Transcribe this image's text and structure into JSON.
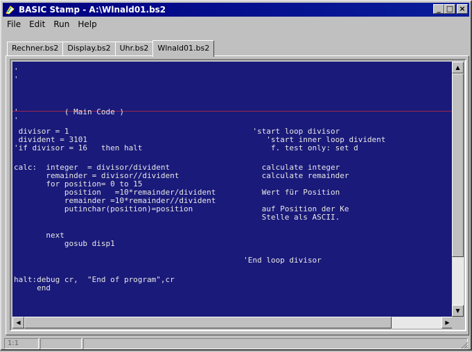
{
  "window": {
    "title": "BASIC Stamp - A:\\Wlnald01.bs2",
    "minimize": "_",
    "maximize": "□",
    "close": "×"
  },
  "menu": [
    "File",
    "Edit",
    "Run",
    "Help"
  ],
  "tabs": [
    {
      "label": "Rechner.bs2",
      "active": false
    },
    {
      "label": "Display.bs2",
      "active": false
    },
    {
      "label": "Uhr.bs2",
      "active": false
    },
    {
      "label": "Wlnald01.bs2",
      "active": true
    }
  ],
  "code_lines": [
    {
      "text": "'",
      "row": 0
    },
    {
      "text": "'",
      "row": 1
    },
    {
      "text": "'          ( Main Code )",
      "row": 2
    },
    {
      "text": "'",
      "row": 3
    },
    {
      "text": " divisor = 1                                        'start loop divisor",
      "row": 4
    },
    {
      "text": " divident = 3101                                       'start inner loop divident",
      "row": 5
    },
    {
      "text": "'if divisor = 16   then halt                            f. test only: set d",
      "row": 6
    },
    {
      "text": "calc:  integer  = divisor/divident                    calculate integer",
      "row": 7
    },
    {
      "text": "       remainder = divisor//divident                  calculate remainder",
      "row": 8
    },
    {
      "text": "       for position= 0 to 15",
      "row": 9
    },
    {
      "text": "           position   =10*remainder/divident          Wert für Position",
      "row": 10
    },
    {
      "text": "           remainder =10*remainder//divident",
      "row": 11
    },
    {
      "text": "           putinchar(position)=position               auf Position der Ke",
      "row": 12
    },
    {
      "text": "                                                      Stelle als ASCII.",
      "row": 13
    },
    {
      "text": "       next",
      "row": 14
    },
    {
      "text": "           gosub disp1",
      "row": 15
    },
    {
      "text": "                                                  'End loop divisor",
      "row": 16
    },
    {
      "text": "halt:debug cr,  \"End of program\",cr",
      "row": 17
    },
    {
      "text": "     end",
      "row": 18
    }
  ],
  "status": [
    "1:1",
    "",
    ""
  ],
  "colors": {
    "editor_bg": "#1a1a7a",
    "code_text": "#e6e6e6",
    "title_bg": "#000080",
    "window_bg": "#c0c0c0"
  }
}
